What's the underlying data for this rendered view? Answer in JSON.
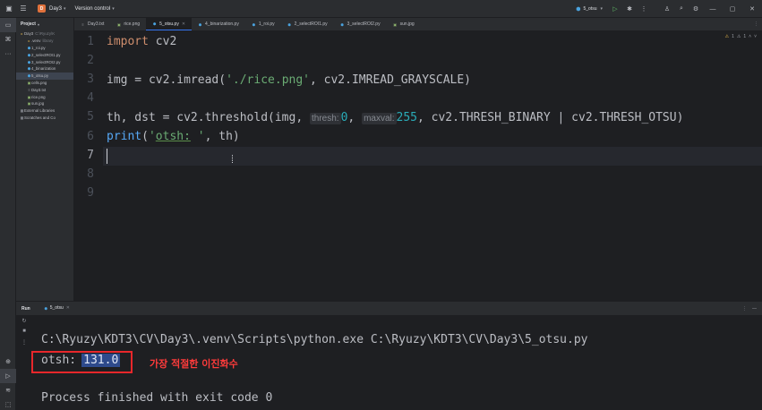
{
  "titlebar": {
    "project_badge": "D",
    "project_name": "Day3",
    "vcs_label": "Version control",
    "run_config": "5_otsu"
  },
  "project_panel": {
    "header": "Project",
    "tree": [
      {
        "label": "Day3",
        "hint": "C:\\Ryuzy\\K",
        "kind": "folder",
        "depth": 0
      },
      {
        "label": ".venv",
        "hint": "library",
        "kind": "folder",
        "depth": 1
      },
      {
        "label": "1_roi.py",
        "kind": "py",
        "depth": 1
      },
      {
        "label": "2_selectROI1.py",
        "kind": "py",
        "depth": 1
      },
      {
        "label": "3_selectROI2.py",
        "kind": "py",
        "depth": 1
      },
      {
        "label": "4_binarization",
        "kind": "py",
        "depth": 1
      },
      {
        "label": "5_otsu.py",
        "kind": "py",
        "depth": 1,
        "selected": true
      },
      {
        "label": "cells.png",
        "kind": "img",
        "depth": 1
      },
      {
        "label": "Day3.txt",
        "kind": "txt",
        "depth": 1
      },
      {
        "label": "rice.png",
        "kind": "img",
        "depth": 1
      },
      {
        "label": "sun.jpg",
        "kind": "img",
        "depth": 1
      },
      {
        "label": "External Libraries",
        "kind": "lib",
        "depth": 0
      },
      {
        "label": "Scratches and Co",
        "kind": "lib",
        "depth": 0
      }
    ]
  },
  "tabs": [
    {
      "label": "Day3.txt",
      "kind": "txt"
    },
    {
      "label": "rice.png",
      "kind": "img"
    },
    {
      "label": "5_otsu.py",
      "kind": "py",
      "active": true
    },
    {
      "label": "4_binarization.py",
      "kind": "py"
    },
    {
      "label": "1_roi.py",
      "kind": "py"
    },
    {
      "label": "2_selectROI1.py",
      "kind": "py"
    },
    {
      "label": "3_selectROI2.py",
      "kind": "py"
    },
    {
      "label": "sun.jpg",
      "kind": "img"
    }
  ],
  "editor": {
    "line_numbers": [
      "1",
      "2",
      "3",
      "4",
      "5",
      "6",
      "7",
      "8",
      "9"
    ],
    "current_line": "7",
    "inspections": {
      "warnings": "1",
      "weak": "1"
    },
    "code": {
      "l1_kw": "import",
      "l1_rest": " cv2",
      "l3_a": "img = cv2.",
      "l3_fn": "imread",
      "l3_b": "(",
      "l3_str": "'./rice.png'",
      "l3_c": ", cv2.IMREAD_GRAYSCALE)",
      "l5_a": "th, dst = cv2.",
      "l5_fn": "threshold",
      "l5_b": "(img, ",
      "l5_hint1": "thresh:",
      "l5_num1": "0",
      "l5_c": ", ",
      "l5_hint2": "maxval:",
      "l5_num2": "255",
      "l5_d": ", cv2.THRESH_BINARY | cv2.THRESH_OTSU)",
      "l6_fn": "print",
      "l6_a": "(",
      "l6_str_q": "'",
      "l6_str_u": "otsh:",
      "l6_str_e": " '",
      "l6_b": ", th)"
    }
  },
  "run_panel": {
    "title": "Run",
    "tab": "5_otsu",
    "console": {
      "command": "C:\\Ryuzy\\KDT3\\CV\\Day3\\.venv\\Scripts\\python.exe C:\\Ryuzy\\KDT3\\CV\\Day3\\5_otsu.py",
      "output_label": "otsh:",
      "output_value": "131.0",
      "exit_message": "Process finished with exit code 0"
    },
    "annotation": "가장 적절한 이진화수",
    "annotation_color": "#ff3b3b"
  },
  "colors": {
    "accent": "#3574f0",
    "keyword": "#cf8e6d",
    "string": "#6aab73",
    "number": "#2aacb8",
    "function": "#56a8f5"
  },
  "icons": {
    "main_menu": "hamburger-icon",
    "run": "play-icon",
    "debug": "bug-icon",
    "search": "search-icon",
    "settings": "gear-icon"
  }
}
